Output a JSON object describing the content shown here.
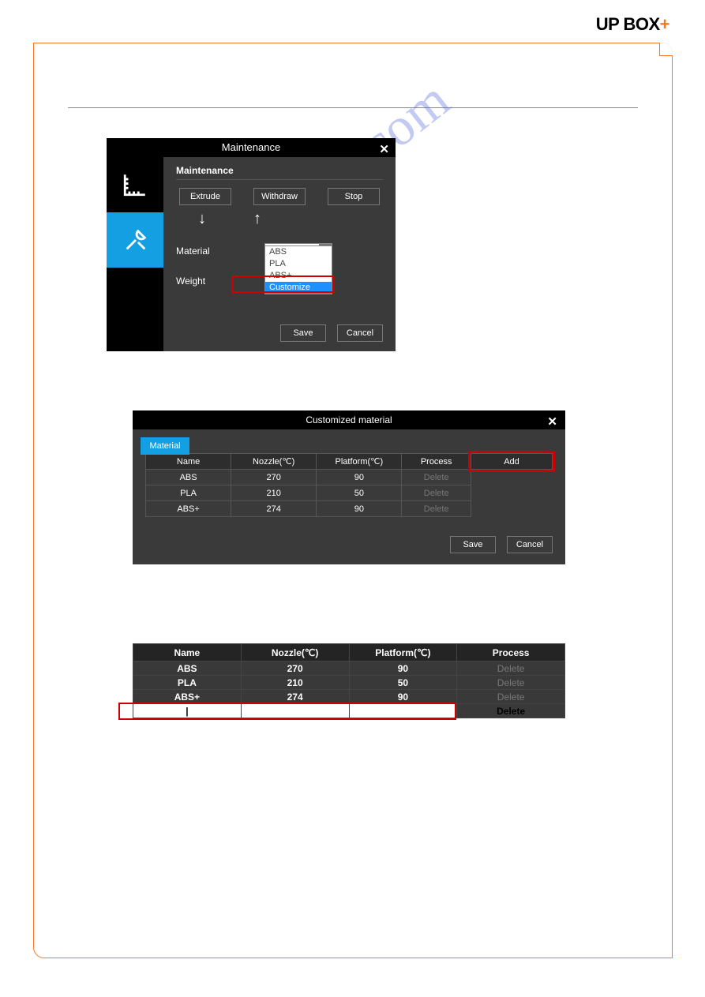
{
  "logo": {
    "text": "UP BOX",
    "plus": "+"
  },
  "watermark": "manualslive.com",
  "dlg1": {
    "title": "Maintenance",
    "close": "✕",
    "section": "Maintenance",
    "buttons": {
      "extrude": "Extrude",
      "withdraw": "Withdraw",
      "stop": "Stop"
    },
    "arrows": {
      "down": "↓",
      "up": "↑"
    },
    "labels": {
      "material": "Material",
      "weight": "Weight"
    },
    "select_value": "ABS",
    "options": {
      "o1": "ABS",
      "o2": "PLA",
      "o3": "ABS+",
      "o4": "Customize"
    },
    "save": "Save",
    "cancel": "Cancel"
  },
  "dlg2": {
    "title": "Customized material",
    "close": "✕",
    "tab": "Material",
    "headers": {
      "name": "Name",
      "nozzle": "Nozzle(℃)",
      "platform": "Platform(℃)",
      "process": "Process",
      "add": "Add"
    },
    "rows": [
      {
        "name": "ABS",
        "nozzle": "270",
        "platform": "90",
        "process": "Delete"
      },
      {
        "name": "PLA",
        "nozzle": "210",
        "platform": "50",
        "process": "Delete"
      },
      {
        "name": "ABS+",
        "nozzle": "274",
        "platform": "90",
        "process": "Delete"
      }
    ],
    "save": "Save",
    "cancel": "Cancel"
  },
  "tbl3": {
    "headers": {
      "name": "Name",
      "nozzle": "Nozzle(℃)",
      "platform": "Platform(℃)",
      "process": "Process"
    },
    "rows": [
      {
        "name": "ABS",
        "nozzle": "270",
        "platform": "90",
        "process": "Delete"
      },
      {
        "name": "PLA",
        "nozzle": "210",
        "platform": "50",
        "process": "Delete"
      },
      {
        "name": "ABS+",
        "nozzle": "274",
        "platform": "90",
        "process": "Delete"
      }
    ],
    "newrow_process": "Delete"
  }
}
